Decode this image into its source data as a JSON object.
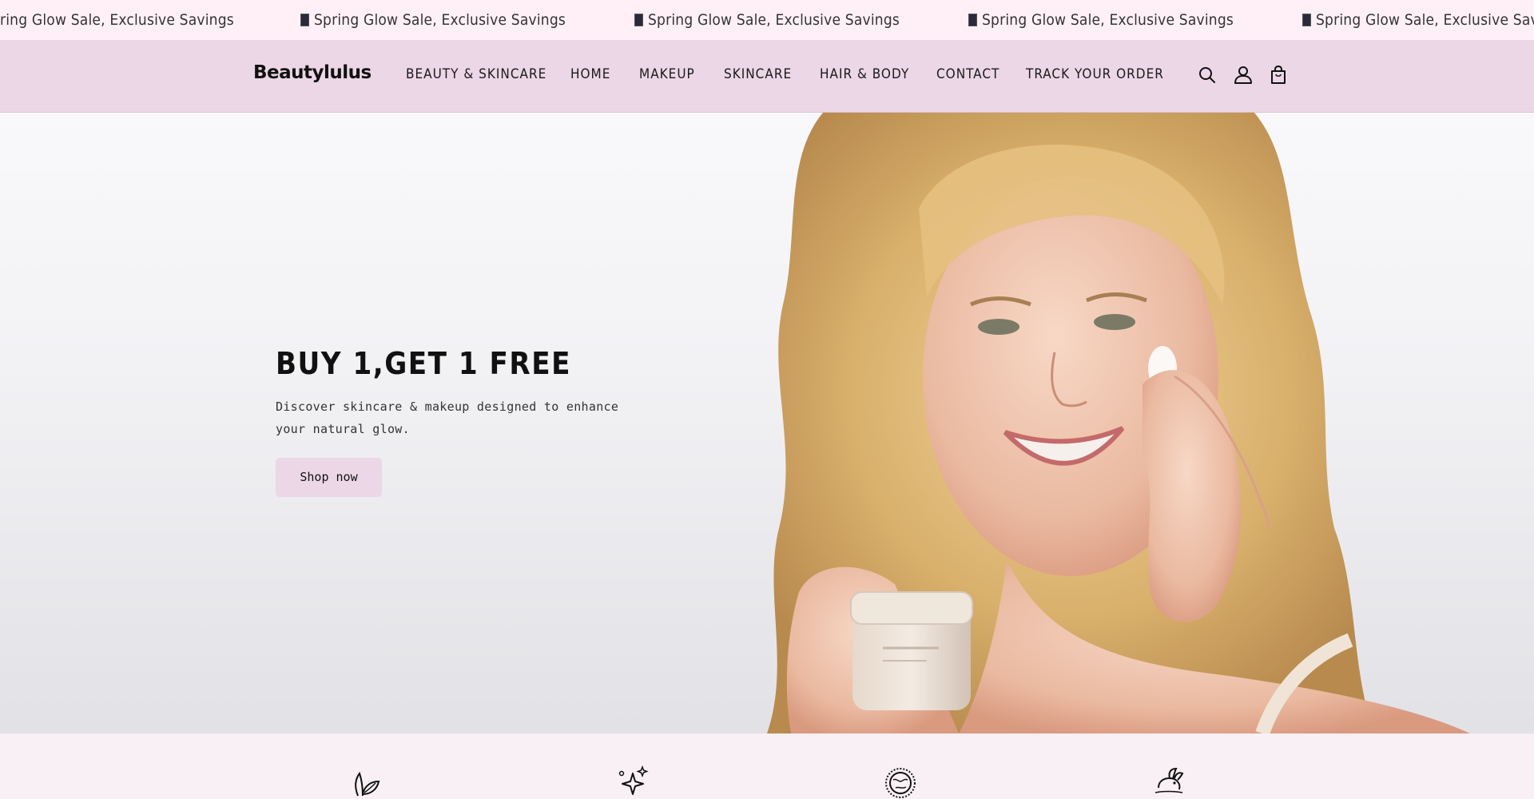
{
  "announcement": {
    "items": [
      "ring Glow Sale, Exclusive Savings",
      "Spring Glow Sale, Exclusive Savings",
      "Spring Glow Sale, Exclusive Savings",
      "Spring Glow Sale, Exclusive Savings",
      "Spring Glow Sale, Exclusive Savi"
    ],
    "icon": "missing-glyph-icon"
  },
  "header": {
    "logo": "Beautylulus",
    "nav": [
      "BEAUTY & SKINCARE",
      "HOME",
      "MAKEUP",
      "SKINCARE",
      "HAIR & BODY",
      "CONTACT",
      "TRACK YOUR ORDER"
    ],
    "icons": [
      "search-icon",
      "account-icon",
      "cart-icon"
    ]
  },
  "hero": {
    "title": "BUY 1,GET 1 FREE",
    "subtitle": "Discover skincare & makeup designed to enhance your natural glow.",
    "cta": "Shop now"
  },
  "features": {
    "icons": [
      "leaf-icon",
      "sparkle-icon",
      "globe-icon",
      "bunny-icon"
    ]
  },
  "colors": {
    "announcement_bg": "#fff0f7",
    "header_bg": "#ecd7e6",
    "button_bg": "#ecd7e6",
    "features_bg": "#f8f0f4"
  }
}
